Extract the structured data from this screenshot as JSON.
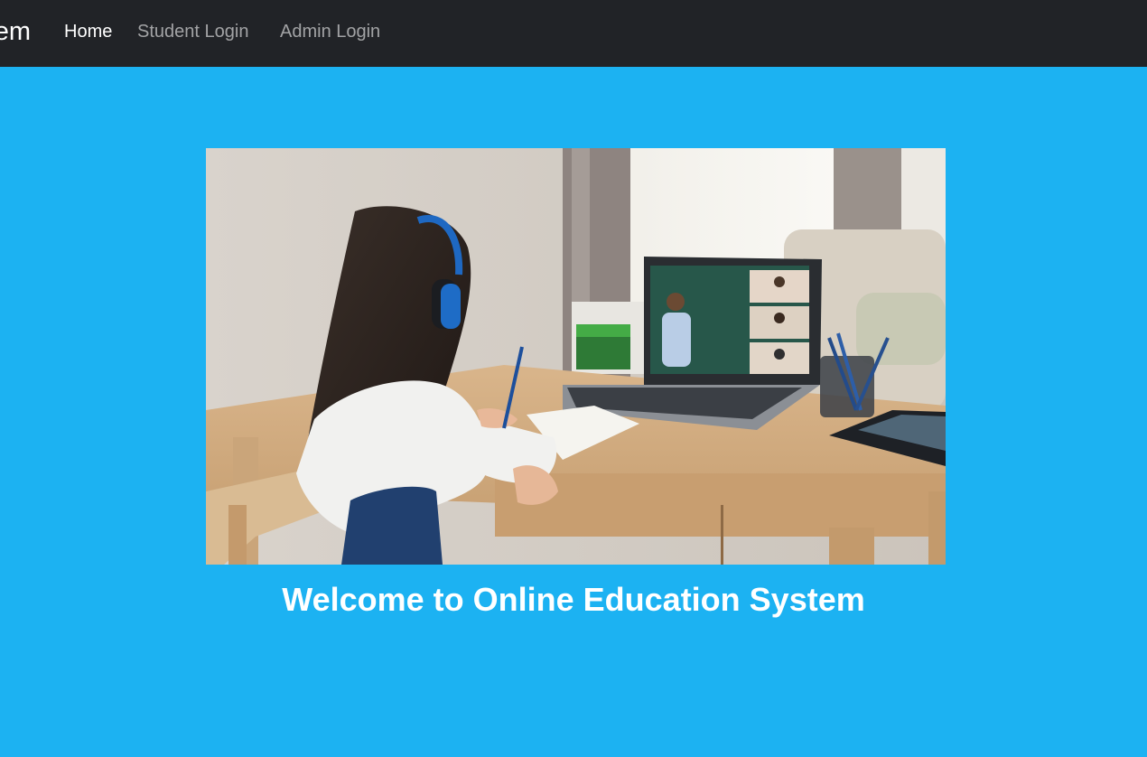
{
  "navbar": {
    "brand": "Online Education System",
    "links": [
      {
        "label": "Home",
        "active": true
      },
      {
        "label": "Student Login",
        "active": false
      },
      {
        "label": "Admin Login",
        "active": false
      }
    ]
  },
  "hero": {
    "image": "girl-video-class-photo"
  },
  "main": {
    "welcome": "Welcome to Online Education System"
  },
  "colors": {
    "navbar_bg": "#212327",
    "page_bg": "#1cb2f2",
    "text": "#ffffff"
  }
}
